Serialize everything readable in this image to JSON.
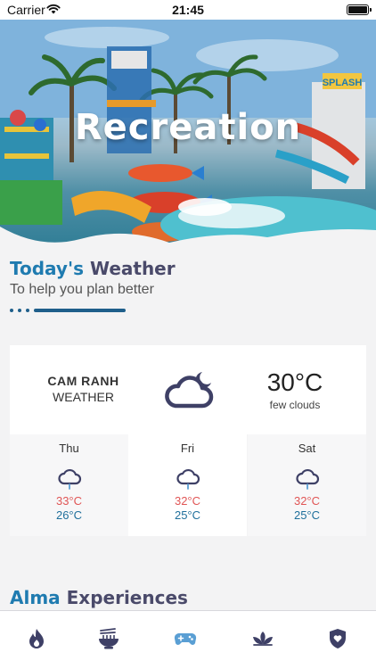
{
  "status_bar": {
    "carrier": "Carrier",
    "time": "21:45"
  },
  "hero": {
    "title": "Recreation",
    "sign_text": "SPLASH"
  },
  "weather_section": {
    "heading_accent": "Today's",
    "heading_rest": "Weather",
    "subheading": "To help you plan better",
    "progress_step": 4,
    "progress_steps": 4
  },
  "current_weather": {
    "city": "CAM RANH",
    "label": "WEATHER",
    "temperature": "30°C",
    "condition": "few clouds",
    "icon": "cloud-moon-icon"
  },
  "forecast": [
    {
      "day": "Thu",
      "high": "33°C",
      "low": "26°C",
      "icon": "rain-cloud-icon"
    },
    {
      "day": "Fri",
      "high": "32°C",
      "low": "25°C",
      "icon": "rain-cloud-icon"
    },
    {
      "day": "Sat",
      "high": "32°C",
      "low": "25°C",
      "icon": "rain-cloud-icon"
    }
  ],
  "experiences": {
    "heading_accent": "Alma",
    "heading_rest": "Experiences"
  },
  "tabbar": {
    "tabs": [
      {
        "icon": "flame-icon",
        "active": false
      },
      {
        "icon": "noodle-bowl-icon",
        "active": false
      },
      {
        "icon": "gamepad-icon",
        "active": true
      },
      {
        "icon": "lotus-icon",
        "active": false
      },
      {
        "icon": "shield-heart-icon",
        "active": false
      }
    ]
  },
  "colors": {
    "accent": "#1f7bb0",
    "heading_dark": "#4a4a6a",
    "temp_high": "#e05555",
    "temp_low": "#1f6f9b",
    "tab_inactive": "#3e4066",
    "tab_active": "#5a9fd4"
  }
}
